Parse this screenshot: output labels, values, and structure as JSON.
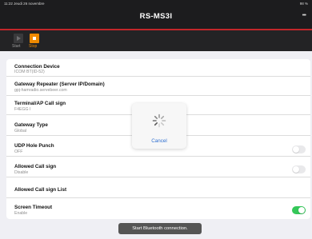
{
  "status_bar": {
    "time": "11:22  Jeudi 26 novembre",
    "right": "98 %"
  },
  "header": {
    "title": "RS-MS3I"
  },
  "toolbar": {
    "start_label": "Start",
    "stop_label": "Stop"
  },
  "settings": [
    {
      "title": "Connection Device",
      "value": "ICOM BT(ID-52)"
    },
    {
      "title": "Gateway Repeater (Server IP/Domain)",
      "value": "gpj-hamradio.servebeer.com"
    },
    {
      "title": "Terminal/AP Call sign",
      "value": "F4EGG  I"
    },
    {
      "title": "Gateway Type",
      "value": "Global"
    },
    {
      "title": "UDP Hole Punch",
      "value": "OFF",
      "toggle": "off"
    },
    {
      "title": "Allowed Call sign",
      "value": "Disable",
      "toggle": "off"
    },
    {
      "title": "Allowed Call sign List",
      "value": ""
    },
    {
      "title": "Screen Timeout",
      "value": "Enable",
      "toggle": "on"
    }
  ],
  "dialog": {
    "cancel_label": "Cancel",
    "spinner_icon": "activity-spinner-icon"
  },
  "toast": {
    "message": "Start Bluetooth connection."
  },
  "colors": {
    "accent": "#f08a00",
    "header_line": "#c2262a",
    "toggle_on": "#34c759",
    "link": "#2f6fd0"
  }
}
